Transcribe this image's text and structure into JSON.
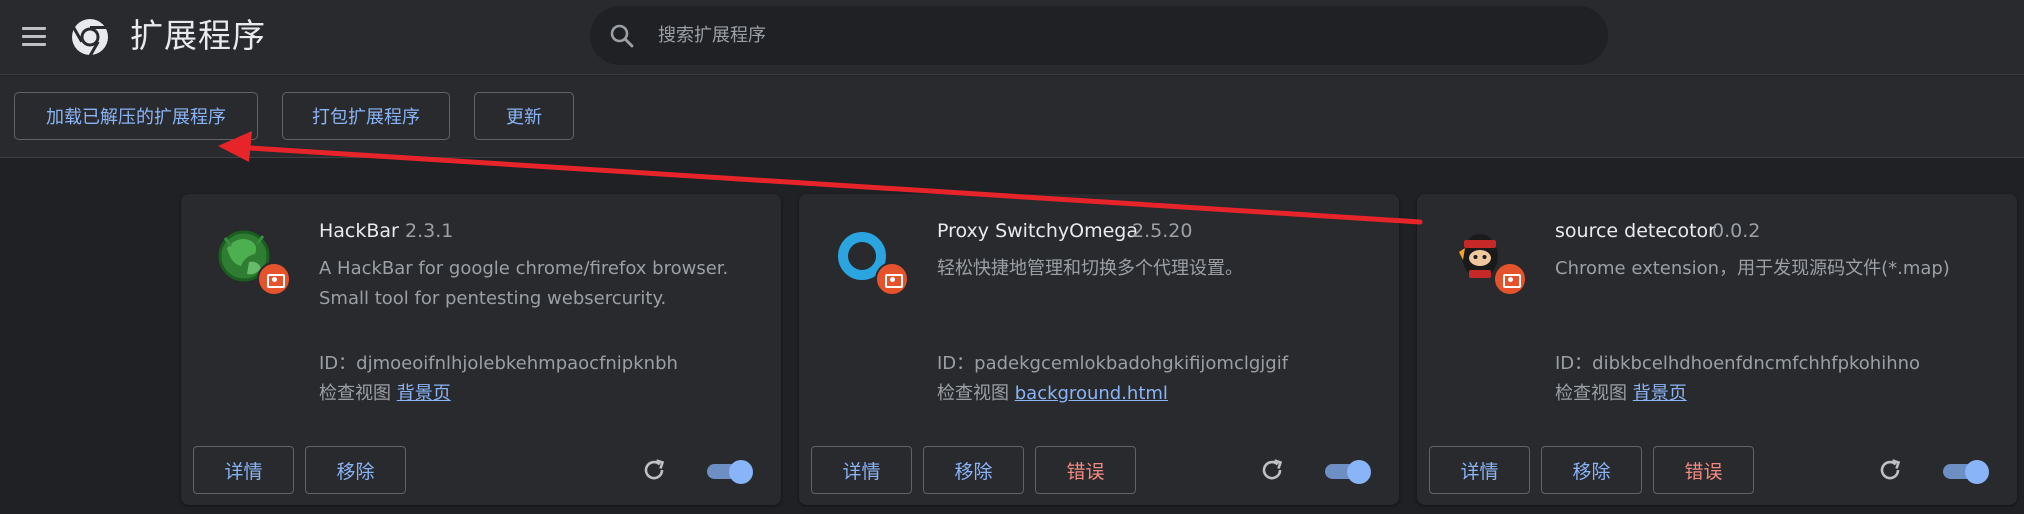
{
  "header": {
    "title": "扩展程序",
    "search_placeholder": "搜索扩展程序"
  },
  "toolbar": {
    "load_unpacked_label": "加载已解压的扩展程序",
    "pack_label": "打包扩展程序",
    "update_label": "更新"
  },
  "extensions": [
    {
      "name": "HackBar",
      "version": "2.3.1",
      "description": "A HackBar for google chrome/firefox browser. Small tool for pentesting websercurity.",
      "id_text": "ID：djmoeoifnlhjolebkehmpaocfnipknbh",
      "inspect_label": "检查视图",
      "inspect_link": "背景页",
      "details_label": "详情",
      "remove_label": "移除",
      "enabled": true,
      "icon": "hackbar-green-globe-icon"
    },
    {
      "name": "Proxy SwitchyOmega",
      "version": "2.5.20",
      "description": "轻松快捷地管理和切换多个代理设置。",
      "id_text": "ID：padekgcemlokbadohgkifijomclgjgif",
      "inspect_label": "检查视图",
      "inspect_link": "background.html",
      "details_label": "详情",
      "remove_label": "移除",
      "errors_label": "错误",
      "enabled": true,
      "icon": "switchyomega-ring-icon"
    },
    {
      "name": "source detecotor",
      "version": "0.0.2",
      "description": "Chrome extension，用于发现源码文件(*.map)",
      "id_text": "ID：dibkbcelhdhoenfdncmfchhfpkohihno",
      "inspect_label": "检查视图",
      "inspect_link": "背景页",
      "details_label": "详情",
      "remove_label": "移除",
      "errors_label": "错误",
      "enabled": true,
      "icon": "ninja-character-icon"
    }
  ],
  "colors": {
    "background": "#202124",
    "surface": "#292a2d",
    "accent": "#8ab4f8",
    "error": "#f28b82",
    "badge": "#e5532d",
    "annotation_arrow": "#e8242b"
  }
}
